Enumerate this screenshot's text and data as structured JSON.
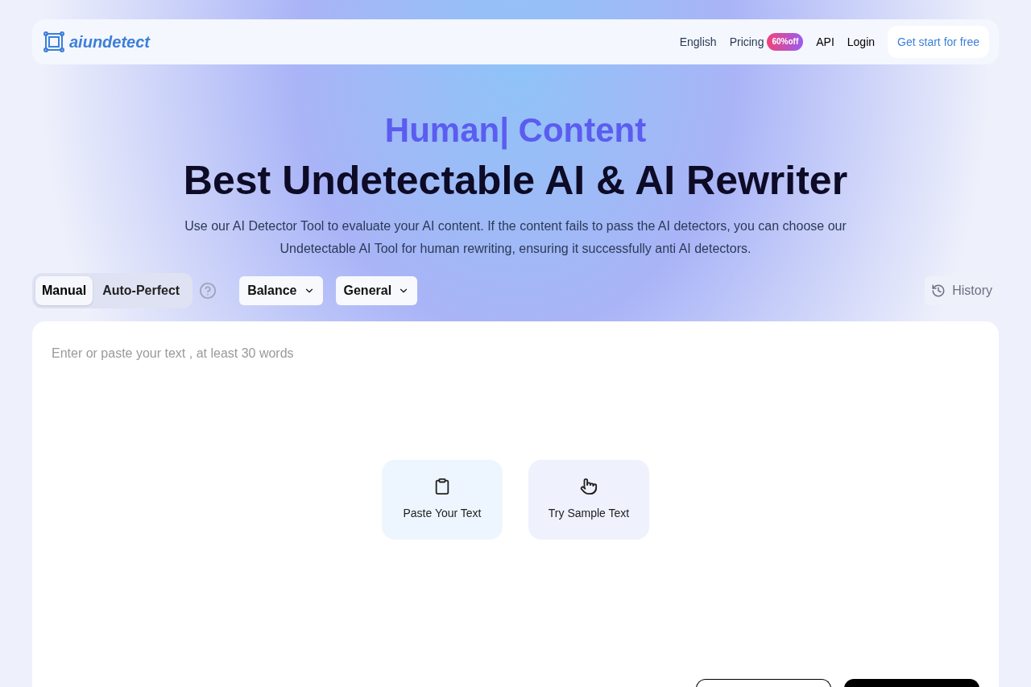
{
  "logo": {
    "text": "aiundetect"
  },
  "nav": {
    "items": [
      {
        "label": "English",
        "kind": "link"
      },
      {
        "label": "Pricing",
        "kind": "badge",
        "badge": "60%off"
      },
      {
        "label": "API",
        "kind": "link"
      },
      {
        "label": "Login",
        "kind": "link"
      }
    ],
    "cta": "Get start for free"
  },
  "hero": {
    "typed": "Human| Content",
    "title": "Best Undetectable AI & AI Rewriter",
    "subtitle": "Use our AI Detector Tool to evaluate your AI content. If the content fails to pass the AI detectors, you can choose our Undetectable AI Tool for human rewriting, ensuring it successfully anti AI detectors."
  },
  "modes": [
    {
      "label": "Manual",
      "selected": true
    },
    {
      "label": "Auto-Perfect",
      "selected": false
    }
  ],
  "dropdowns": [
    {
      "value": "Balance"
    },
    {
      "value": "General"
    }
  ],
  "history": "History",
  "editor": {
    "placeholder": "Enter or paste your text , at least 30 words",
    "actions": [
      {
        "label": "Paste Your Text",
        "kind": "paste"
      },
      {
        "label": "Try Sample Text",
        "kind": "sample"
      }
    ]
  }
}
